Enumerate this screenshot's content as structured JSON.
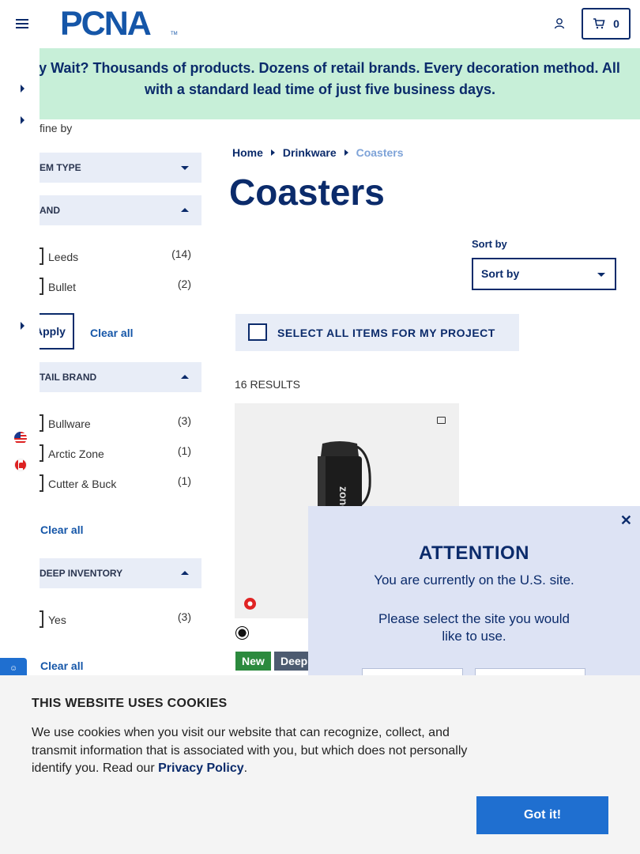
{
  "header": {
    "logo_text": "PCNA",
    "logo_tm": "TM",
    "cart_count": "0"
  },
  "banner": {
    "line1": "y Wait? Thousands of products. Dozens of retail brands. Every decoration method. All",
    "line2": "with a standard lead time of just five business days."
  },
  "filters": {
    "refine_label": "fine by",
    "facets": [
      {
        "title": "EM TYPE",
        "expanded": false
      },
      {
        "title": "AND",
        "expanded": true,
        "options": [
          {
            "label": "Leeds",
            "count": "(14)"
          },
          {
            "label": "Bullet",
            "count": "(2)"
          }
        ],
        "apply_label": "Apply",
        "clear_label": "Clear all"
      },
      {
        "title": "TAIL BRAND",
        "expanded": true,
        "options": [
          {
            "label": "Bullware",
            "count": "(3)"
          },
          {
            "label": "Arctic Zone",
            "count": "(1)"
          },
          {
            "label": "Cutter & Buck",
            "count": "(1)"
          }
        ],
        "clear_label": "Clear all"
      },
      {
        "title": "DEEP INVENTORY",
        "expanded": true,
        "options": [
          {
            "label": "Yes",
            "count": "(3)"
          }
        ],
        "clear_label": "Clear all"
      }
    ]
  },
  "breadcrumb": {
    "items": [
      "Home",
      "Drinkware",
      "Coasters"
    ]
  },
  "page": {
    "title": "Coasters",
    "sort_label": "Sort by",
    "sort_value": "Sort by",
    "select_all": "SELECT ALL ITEMS FOR MY PROJECT",
    "results": "16 RESULTS"
  },
  "product": {
    "tumbler_text": "zone",
    "badges": [
      "New",
      "Deep"
    ]
  },
  "modal": {
    "close": "✕",
    "title": "ATTENTION",
    "line1": "You are currently on the U.S. site.",
    "line2": "Please select the site you would",
    "line3": "like to use."
  },
  "cookie": {
    "title": "THIS WEBSITE USES COOKIES",
    "text": "We use cookies when you visit our website that can recognize, collect, and transmit information that is associated with you, but which does not personally identify you. Read our ",
    "link": "Privacy Policy",
    "text_end": ".",
    "button": "Got it!"
  },
  "colors": {
    "navy": "#0b2b6b",
    "brand_blue": "#1556a8",
    "banner_green": "#c7efd8",
    "facet_bg": "#e8edf7",
    "new_badge": "#2c8a3e",
    "deep_badge": "#4d5b70",
    "cookie_button": "#1f6fd0"
  }
}
